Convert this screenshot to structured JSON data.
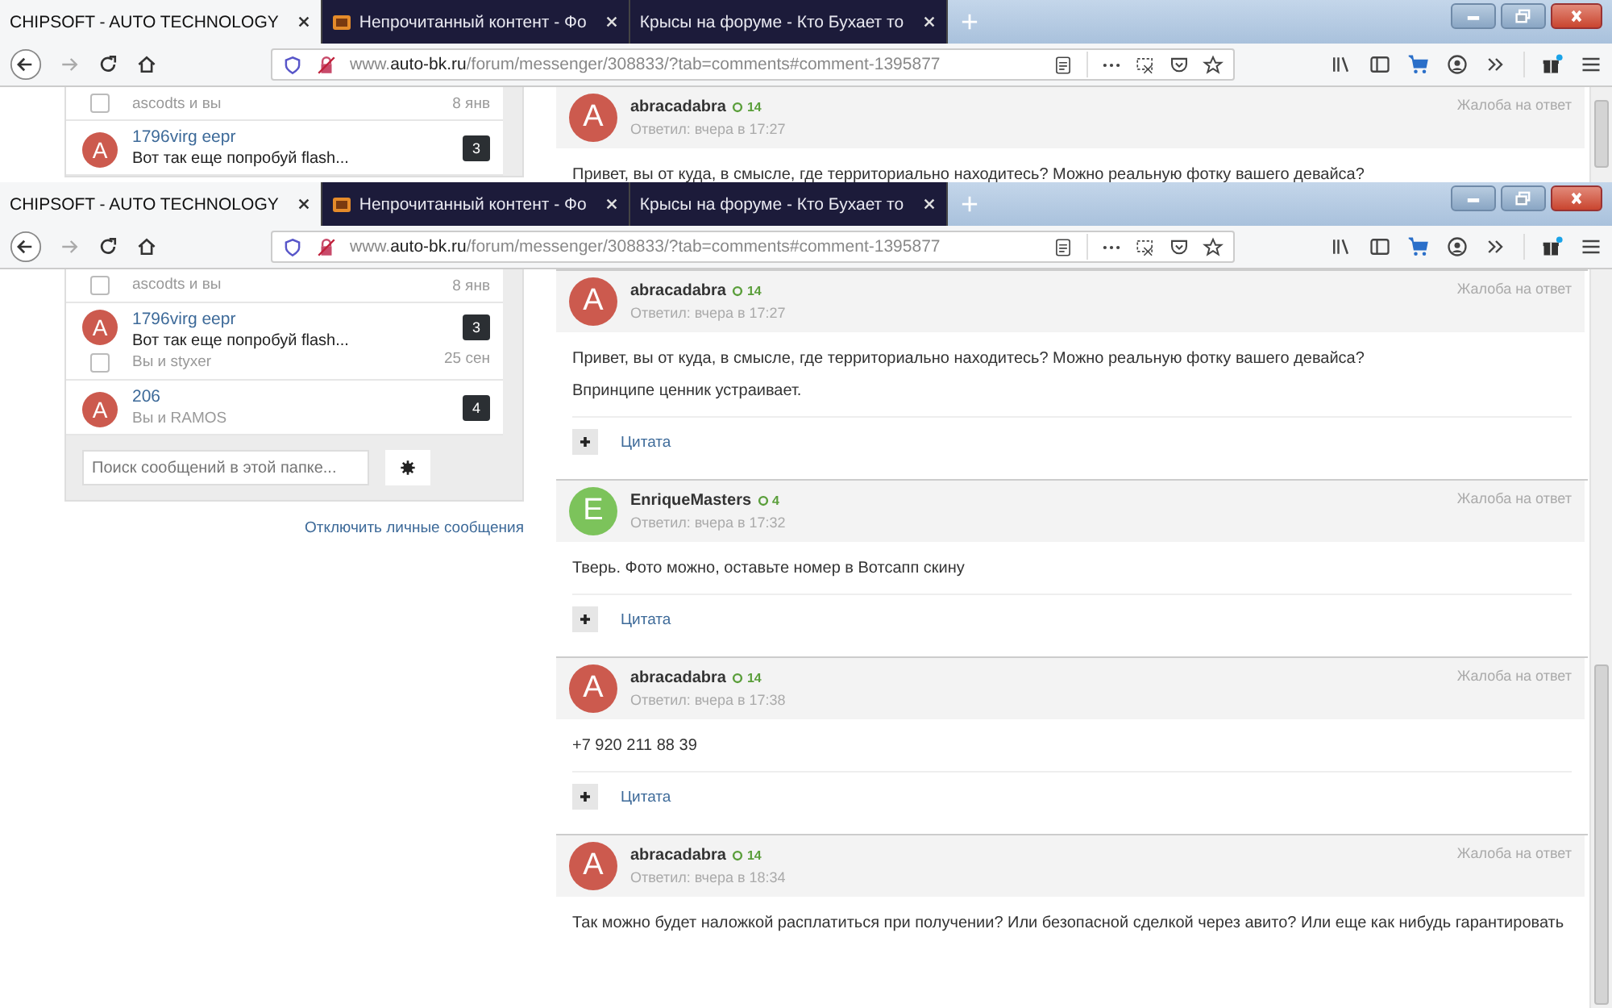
{
  "windows": [
    {
      "tabs": [
        {
          "label": "CHIPSOFT - AUTO TECHNOLOGY",
          "selected": true,
          "favicon": false
        },
        {
          "label": "Непрочитанный контент - Фо",
          "selected": false,
          "favicon": true
        },
        {
          "label": "Крысы на форуме - Кто Бухает то",
          "selected": false,
          "favicon": false
        }
      ],
      "address": "www.**auto-bk.ru**/forum/messenger/308833/?tab=comments#comment-1395877",
      "conversations": [
        {
          "participants": "ascodts и вы",
          "date": "8 янв",
          "checked": false
        },
        {
          "avatar_letter": "A",
          "color": "#cc5a4e",
          "name": "1796virg eepr",
          "preview": "Вот так еще попробуй flash...",
          "badge": "3"
        }
      ],
      "comments": [
        {
          "avatar_letter": "A",
          "color": "#cc5a4e",
          "author": "abracadabra",
          "reputation": "14",
          "time": "Ответил: вчера в 17:27",
          "complaint": "Жалоба на ответ",
          "texts": [
            "Привет, вы от куда, в смысле, где территориально находитесь? Можно реальную фотку вашего девайса?"
          ]
        }
      ]
    },
    {
      "tabs": [
        {
          "label": "CHIPSOFT - AUTO TECHNOLOGY",
          "selected": true,
          "favicon": false
        },
        {
          "label": "Непрочитанный контент - Фо",
          "selected": false,
          "favicon": true
        },
        {
          "label": "Крысы на форуме - Кто Бухает то",
          "selected": false,
          "favicon": false
        }
      ],
      "address": "www.**auto-bk.ru**/forum/messenger/308833/?tab=comments#comment-1395877",
      "conversations": [
        {
          "participants": "ascodts и вы",
          "date": "8 янв",
          "checked": false
        },
        {
          "avatar_letter": "A",
          "color": "#cc5a4e",
          "name": "1796virg eepr",
          "preview": "Вот так еще попробуй flash...",
          "participants": "Вы и styxer",
          "date": "25 сен",
          "badge": "3",
          "checked": false
        },
        {
          "avatar_letter": "A",
          "color": "#cc5a4e",
          "name": "206",
          "participants": "Вы и RAMOS",
          "badge": "4"
        }
      ],
      "search": {
        "placeholder": "Поиск сообщений в этой папке..."
      },
      "disable_link": "Отключить личные сообщения",
      "comments": [
        {
          "avatar_letter": "A",
          "color": "#cc5a4e",
          "author": "abracadabra",
          "reputation": "14",
          "time": "Ответил: вчера в 17:27",
          "complaint": "Жалоба на ответ",
          "texts": [
            "Привет, вы от куда, в смысле, где территориально находитесь? Можно реальную фотку вашего девайса?",
            "Впринципе ценник устраивает."
          ],
          "quote": "Цитата"
        },
        {
          "avatar_letter": "E",
          "color": "#7cc35b",
          "author": "EnriqueMasters",
          "reputation": "4",
          "time": "Ответил: вчера в 17:32",
          "complaint": "Жалоба на ответ",
          "texts": [
            "Тверь. Фото можно, оставьте номер в Вотсапп скину"
          ],
          "quote": "Цитата"
        },
        {
          "avatar_letter": "A",
          "color": "#cc5a4e",
          "author": "abracadabra",
          "reputation": "14",
          "time": "Ответил: вчера в 17:38",
          "complaint": "Жалоба на ответ",
          "texts": [
            "+7 920 211 88 39"
          ],
          "quote": "Цитата"
        },
        {
          "avatar_letter": "A",
          "color": "#cc5a4e",
          "author": "abracadabra",
          "reputation": "14",
          "time": "Ответил: вчера в 18:34",
          "complaint": "Жалоба на ответ",
          "texts": [
            "Так можно будет наложкой расплатиться при получении? Или безопасной сделкой через авито? Или еще как нибудь гарантировать"
          ]
        }
      ]
    }
  ]
}
